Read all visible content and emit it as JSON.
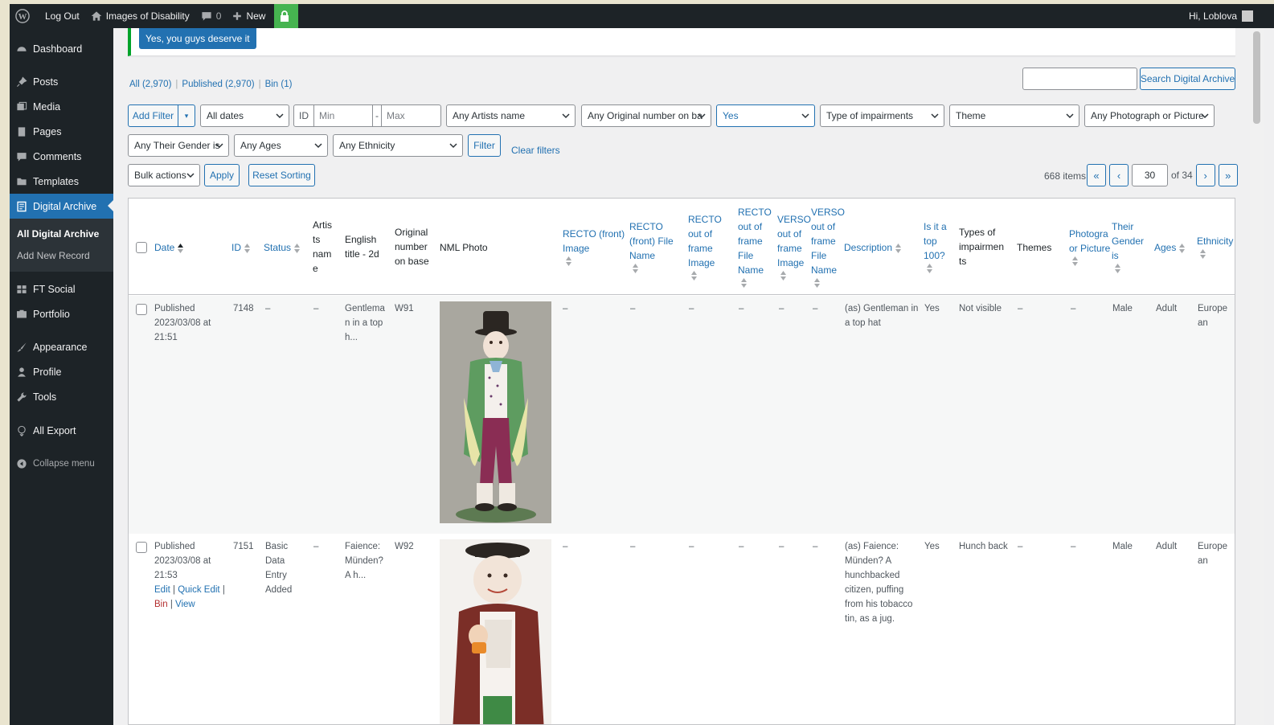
{
  "admin_bar": {
    "log_out": "Log Out",
    "site_name": "Images of Disability",
    "comments_count": "0",
    "new_label": "New",
    "greeting": "Hi, Loblova"
  },
  "notice": {
    "button_label": "Yes, you guys deserve it"
  },
  "sidebar": {
    "items": [
      {
        "label": "Dashboard",
        "icon": "dashboard-icon"
      },
      {
        "label": "Posts",
        "icon": "pin-icon"
      },
      {
        "label": "Media",
        "icon": "media-icon"
      },
      {
        "label": "Pages",
        "icon": "page-icon"
      },
      {
        "label": "Comments",
        "icon": "comment-icon"
      },
      {
        "label": "Templates",
        "icon": "folder-icon"
      },
      {
        "label": "Digital Archive",
        "icon": "archive-icon"
      },
      {
        "label": "FT Social",
        "icon": "social-icon"
      },
      {
        "label": "Portfolio",
        "icon": "portfolio-icon"
      },
      {
        "label": "Appearance",
        "icon": "brush-icon"
      },
      {
        "label": "Profile",
        "icon": "user-icon"
      },
      {
        "label": "Tools",
        "icon": "wrench-icon"
      },
      {
        "label": "All Export",
        "icon": "export-icon"
      }
    ],
    "submenu": [
      "All Digital Archive",
      "Add New Record"
    ],
    "collapse": "Collapse menu"
  },
  "views": {
    "all": "All (2,970)",
    "published": "Published (2,970)",
    "bin": "Bin (1)"
  },
  "search": {
    "button": "Search Digital Archive",
    "value": ""
  },
  "filters": {
    "add_filter": "Add Filter",
    "dates": "All dates",
    "id_label": "ID",
    "min_placeholder": "Min",
    "max_placeholder": "Max",
    "artists": "Any Artists name",
    "original_number": "Any Original number on ba",
    "top100": "Yes",
    "impairments": "Type of impairments",
    "theme": "Theme",
    "photograph": "Any Photograph or Picture",
    "gender": "Any Their Gender is",
    "ages": "Any Ages",
    "ethnicity": "Any Ethnicity",
    "filter_button": "Filter",
    "clear_filters": "Clear filters"
  },
  "actions": {
    "bulk": "Bulk actions",
    "apply": "Apply",
    "reset_sorting": "Reset Sorting"
  },
  "pagination": {
    "items": "668 items",
    "first": "«",
    "prev": "‹",
    "current": "30",
    "of": "of 34",
    "next": "›",
    "last": "»"
  },
  "columns": {
    "date": "Date",
    "id": "ID",
    "status": "Status",
    "artists": [
      "Artis",
      "ts",
      "nam",
      "e"
    ],
    "english_title": [
      "English",
      "title - 2d"
    ],
    "original_number": [
      "Original",
      "number",
      "on base"
    ],
    "nml_photo": "NML Photo",
    "recto_image": [
      "RECTO (front)",
      "Image"
    ],
    "recto_file": [
      "RECTO",
      "(front) File",
      "Name"
    ],
    "recto_oof_image": [
      "RECTO",
      "out of",
      "frame",
      "Image"
    ],
    "recto_oof_file": [
      "RECTO",
      "out of",
      "frame",
      "File",
      "Name"
    ],
    "verso_oof_image": [
      "VERSO",
      "out of",
      "frame",
      "Image"
    ],
    "verso_oof_file": [
      "VERSO",
      "out of",
      "frame",
      "File",
      "Name"
    ],
    "description": "Description",
    "top100": [
      "Is it a",
      "top",
      "100?"
    ],
    "impairments": [
      "Types of",
      "impairmen",
      "ts"
    ],
    "themes": "Themes",
    "photograph": [
      "Photogra",
      "or Picture"
    ],
    "gender": [
      "Their",
      "Gender",
      "is"
    ],
    "ages": "Ages",
    "ethnicity": "Ethnicity"
  },
  "rows": [
    {
      "status_line": "Published",
      "date_line1": "2023/03/08 at",
      "date_line2": "21:51",
      "id": "7148",
      "status": [
        "–"
      ],
      "artists": "–",
      "title": [
        "Gentlema",
        "n in a top",
        "h..."
      ],
      "original": "W91",
      "recto_image": "–",
      "recto_file": "–",
      "recto_oof_image": "–",
      "recto_oof_file": "–",
      "verso_oof_image": "–",
      "verso_oof_file": "–",
      "description": [
        "(as) Gentleman in",
        "a top hat"
      ],
      "top100": "Yes",
      "impairment": "Not visible",
      "themes": "–",
      "photograph": "–",
      "gender": "Male",
      "ages": "Adult",
      "ethnicity": [
        "Europe",
        "an"
      ]
    },
    {
      "status_line": "Published",
      "date_line1": "2023/03/08 at",
      "date_line2": "21:53",
      "id": "7151",
      "status": [
        "Basic",
        "Data",
        "Entry",
        "Added"
      ],
      "artists": "–",
      "title": [
        "Faience:",
        "Münden?",
        "A h..."
      ],
      "original": "W92",
      "recto_image": "–",
      "recto_file": "–",
      "recto_oof_image": "–",
      "recto_oof_file": "–",
      "verso_oof_image": "–",
      "verso_oof_file": "–",
      "description": [
        "(as) Faience:",
        "Münden? A",
        "hunchbacked",
        "citizen, puffing",
        "from his tobacco",
        "tin, as a jug."
      ],
      "top100": "Yes",
      "impairment": "Hunch back",
      "themes": "–",
      "photograph": "–",
      "gender": "Male",
      "ages": "Adult",
      "ethnicity": [
        "Europe",
        "an"
      ],
      "row_actions": {
        "edit": "Edit",
        "quick_edit": "Quick Edit",
        "bin": "Bin",
        "view": "View"
      }
    }
  ],
  "colors": {
    "accent": "#2271b1",
    "adminbar": "#1d2327",
    "success": "#00a32a"
  }
}
